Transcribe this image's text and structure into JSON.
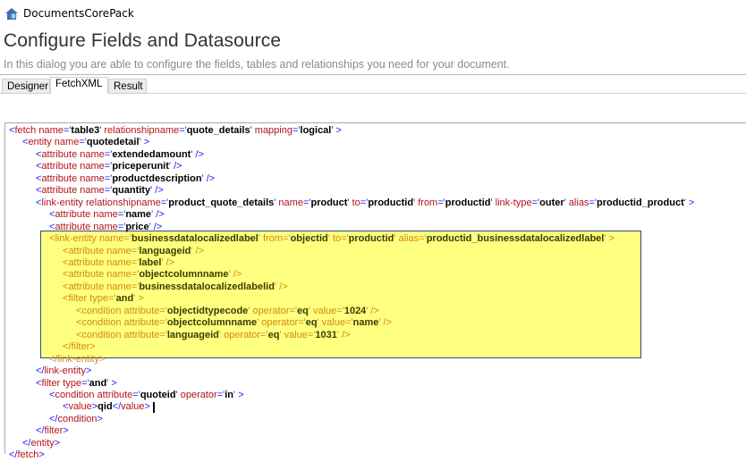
{
  "window": {
    "title": "DocumentsCorePack",
    "icon": "app-house-icon"
  },
  "header": {
    "title": "Configure Fields and Datasource",
    "subtitle": "In this dialog you are able to configure the fields, tables and relationships you need for your document."
  },
  "tabs": [
    {
      "label": "Designer",
      "active": false
    },
    {
      "label": "FetchXML",
      "active": true
    },
    {
      "label": "Result",
      "active": false
    }
  ],
  "colors": {
    "highlight": "#ffff80",
    "highlight_border": "#2e4a8c",
    "tag": "#b4121a",
    "punct": "#1a1aff",
    "highlight_text": "#d08a10"
  },
  "code": {
    "cursor_line": 23,
    "lines": [
      {
        "level": 0,
        "hl": false,
        "text": "<fetch name='table3' relationshipname='quote_details' mapping='logical' >"
      },
      {
        "level": 1,
        "hl": false,
        "text": "<entity name='quotedetail' >"
      },
      {
        "level": 2,
        "hl": false,
        "text": "<attribute name='extendedamount' />"
      },
      {
        "level": 2,
        "hl": false,
        "text": "<attribute name='priceperunit' />"
      },
      {
        "level": 2,
        "hl": false,
        "text": "<attribute name='productdescription' />"
      },
      {
        "level": 2,
        "hl": false,
        "text": "<attribute name='quantity' />"
      },
      {
        "level": 2,
        "hl": false,
        "text": "<link-entity relationshipname='product_quote_details' name='product' to='productid' from='productid' link-type='outer' alias='productid_product' >"
      },
      {
        "level": 3,
        "hl": false,
        "text": "<attribute name='name' />"
      },
      {
        "level": 3,
        "hl": false,
        "text": "<attribute name='price' />"
      },
      {
        "level": 3,
        "hl": true,
        "text": "<link-entity name='businessdatalocalizedlabel' from='objectid' to='productid' alias='productid_businessdatalocalizedlabel' >"
      },
      {
        "level": 4,
        "hl": true,
        "text": "<attribute name='languageid' />"
      },
      {
        "level": 4,
        "hl": true,
        "text": "<attribute name='label' />"
      },
      {
        "level": 4,
        "hl": true,
        "text": "<attribute name='objectcolumnname' />"
      },
      {
        "level": 4,
        "hl": true,
        "text": "<attribute name='businessdatalocalizedlabelid' />"
      },
      {
        "level": 4,
        "hl": true,
        "text": "<filter type='and' >"
      },
      {
        "level": 5,
        "hl": true,
        "text": "<condition attribute='objectidtypecode' operator='eq' value='1024' />"
      },
      {
        "level": 5,
        "hl": true,
        "text": "<condition attribute='objectcolumnname' operator='eq' value='name' />"
      },
      {
        "level": 5,
        "hl": true,
        "text": "<condition attribute='languageid' operator='eq' value='1031' />"
      },
      {
        "level": 4,
        "hl": true,
        "text": "</filter>"
      },
      {
        "level": 3,
        "hl": true,
        "text": "</link-entity>"
      },
      {
        "level": 2,
        "hl": false,
        "text": "</link-entity>"
      },
      {
        "level": 2,
        "hl": false,
        "text": "<filter type='and' >"
      },
      {
        "level": 3,
        "hl": false,
        "text": "<condition attribute='quoteid' operator='in' >"
      },
      {
        "level": 4,
        "hl": false,
        "text": "<value>qid</value>"
      },
      {
        "level": 3,
        "hl": false,
        "text": "</condition>"
      },
      {
        "level": 2,
        "hl": false,
        "text": "</filter>"
      },
      {
        "level": 1,
        "hl": false,
        "text": "</entity>"
      },
      {
        "level": 0,
        "hl": false,
        "text": "</fetch>"
      }
    ]
  }
}
